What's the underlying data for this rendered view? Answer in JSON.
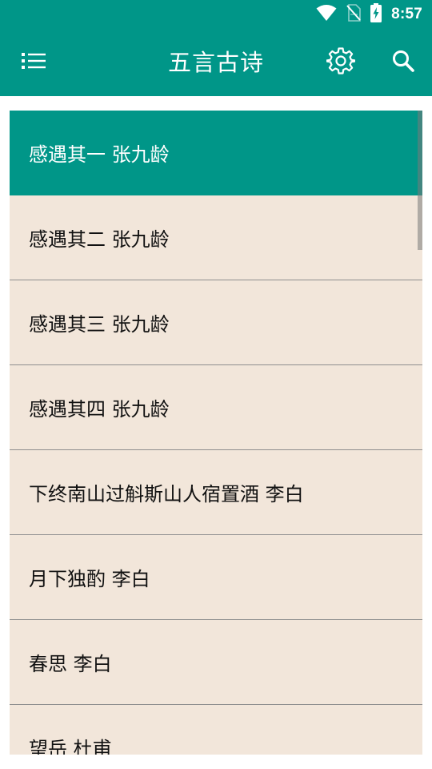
{
  "status_bar": {
    "time": "8:57",
    "icons": [
      "wifi-icon",
      "no-sim-icon",
      "battery-charging-icon"
    ]
  },
  "app_bar": {
    "title": "五言古诗",
    "menu_icon": "list-menu-icon",
    "settings_icon": "gear-icon",
    "search_icon": "search-icon"
  },
  "colors": {
    "primary": "#009688",
    "list_background": "#f2e6da",
    "divider": "#8e8e8e"
  },
  "poems": [
    {
      "label": "感遇其一 张九龄",
      "selected": true
    },
    {
      "label": "感遇其二 张九龄",
      "selected": false
    },
    {
      "label": "感遇其三 张九龄",
      "selected": false
    },
    {
      "label": "感遇其四 张九龄",
      "selected": false
    },
    {
      "label": "下终南山过斛斯山人宿置酒 李白",
      "selected": false
    },
    {
      "label": "月下独酌 李白",
      "selected": false
    },
    {
      "label": "春思 李白",
      "selected": false
    },
    {
      "label": "望岳 杜甫",
      "selected": false
    }
  ]
}
